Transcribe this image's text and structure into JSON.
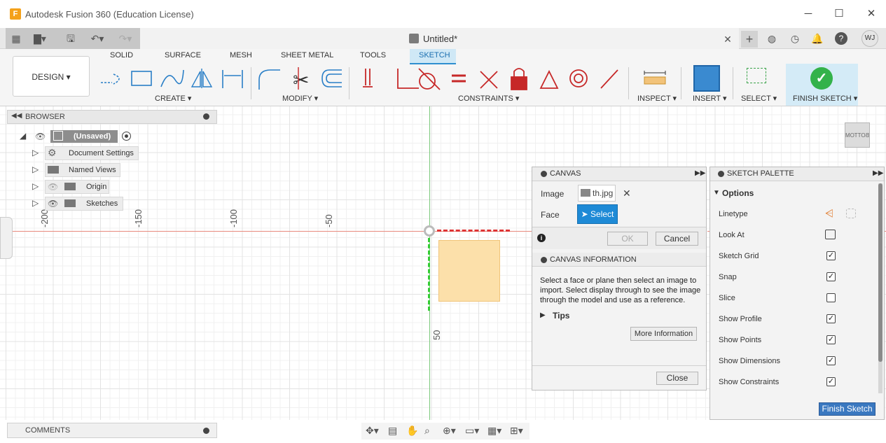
{
  "window": {
    "title": "Autodesk Fusion 360 (Education License)",
    "logo_letter": "F",
    "minimize": "─",
    "maximize": "☐",
    "close": "✕"
  },
  "document": {
    "title": "Untitled*",
    "close": "✕",
    "new_tab": "+",
    "user_initials": "WJ"
  },
  "ribbon": {
    "workspace": "DESIGN ▾",
    "tabs": [
      "SOLID",
      "SURFACE",
      "MESH",
      "SHEET METAL",
      "TOOLS",
      "SKETCH"
    ],
    "active_tab": "SKETCH",
    "groups": {
      "create": "CREATE ▾",
      "modify": "MODIFY ▾",
      "constraints": "CONSTRAINTS ▾",
      "inspect": "INSPECT ▾",
      "insert": "INSERT ▾",
      "select": "SELECT ▾",
      "finish": "FINISH SKETCH ▾"
    }
  },
  "browser": {
    "title": "BROWSER",
    "root": "(Unsaved)",
    "items": [
      {
        "label": "Document Settings",
        "icon": "gear-icon"
      },
      {
        "label": "Named Views",
        "icon": "folder-icon"
      },
      {
        "label": "Origin",
        "icon": "folder-icon"
      },
      {
        "label": "Sketches",
        "icon": "folder-icon"
      }
    ]
  },
  "rulers": {
    "h": [
      "-200",
      "-150",
      "-100",
      "-50"
    ],
    "v": [
      "50"
    ]
  },
  "canvas_dialog": {
    "title": "CANVAS",
    "image_label": "Image",
    "image_value": "th.jpg",
    "face_label": "Face",
    "select_label": "Select",
    "ok": "OK",
    "cancel": "Cancel",
    "info_title": "CANVAS INFORMATION",
    "info_text": "Select a face or plane then select an image to import. Select display through to see the image through the model and use as a reference.",
    "tips": "Tips",
    "more_info": "More Information",
    "close": "Close"
  },
  "palette": {
    "title": "SKETCH PALETTE",
    "section": "Options",
    "rows": [
      {
        "label": "Linetype"
      },
      {
        "label": "Look At"
      },
      {
        "label": "Sketch Grid",
        "checked": true
      },
      {
        "label": "Snap",
        "checked": true
      },
      {
        "label": "Slice",
        "checked": false
      },
      {
        "label": "Show Profile",
        "checked": true
      },
      {
        "label": "Show Points",
        "checked": true
      },
      {
        "label": "Show Dimensions",
        "checked": true
      },
      {
        "label": "Show Constraints",
        "checked": true
      }
    ],
    "finish": "Finish Sketch"
  },
  "comments": {
    "title": "COMMENTS"
  },
  "viewcube": {
    "label": "BOTTOM"
  },
  "colors": {
    "accent": "#1e8ad6",
    "finish_green": "#33b24a",
    "axis_x": "#e8897d",
    "axis_y": "#7ac87a"
  }
}
